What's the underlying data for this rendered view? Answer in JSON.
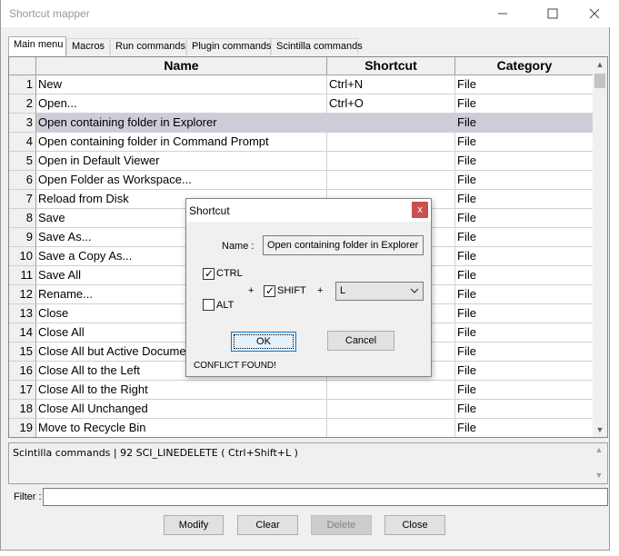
{
  "window": {
    "title": "Shortcut mapper"
  },
  "tabs": [
    "Main menu",
    "Macros",
    "Run commands",
    "Plugin commands",
    "Scintilla commands"
  ],
  "table": {
    "columns": [
      "Name",
      "Shortcut",
      "Category"
    ],
    "rows": [
      {
        "num": "1",
        "name": "New",
        "shortcut": "Ctrl+N",
        "category": "File"
      },
      {
        "num": "2",
        "name": "Open...",
        "shortcut": "Ctrl+O",
        "category": "File"
      },
      {
        "num": "3",
        "name": "Open containing folder in Explorer",
        "shortcut": "",
        "category": "File"
      },
      {
        "num": "4",
        "name": "Open containing folder in Command Prompt",
        "shortcut": "",
        "category": "File"
      },
      {
        "num": "5",
        "name": "Open in Default Viewer",
        "shortcut": "",
        "category": "File"
      },
      {
        "num": "6",
        "name": "Open Folder as Workspace...",
        "shortcut": "",
        "category": "File"
      },
      {
        "num": "7",
        "name": "Reload from Disk",
        "shortcut": "",
        "category": "File"
      },
      {
        "num": "8",
        "name": "Save",
        "shortcut": "",
        "category": "File"
      },
      {
        "num": "9",
        "name": "Save As...",
        "shortcut": "",
        "category": "File"
      },
      {
        "num": "10",
        "name": "Save a Copy As...",
        "shortcut": "",
        "category": "File"
      },
      {
        "num": "11",
        "name": "Save All",
        "shortcut": "",
        "category": "File"
      },
      {
        "num": "12",
        "name": "Rename...",
        "shortcut": "",
        "category": "File"
      },
      {
        "num": "13",
        "name": "Close",
        "shortcut": "",
        "category": "File"
      },
      {
        "num": "14",
        "name": "Close All",
        "shortcut": "",
        "category": "File"
      },
      {
        "num": "15",
        "name": "Close All but Active Docume",
        "shortcut": "",
        "category": "File"
      },
      {
        "num": "16",
        "name": "Close All to the Left",
        "shortcut": "",
        "category": "File"
      },
      {
        "num": "17",
        "name": "Close All to the Right",
        "shortcut": "",
        "category": "File"
      },
      {
        "num": "18",
        "name": "Close All Unchanged",
        "shortcut": "",
        "category": "File"
      },
      {
        "num": "19",
        "name": "Move to Recycle Bin",
        "shortcut": "",
        "category": "File"
      }
    ],
    "selected_row": "3"
  },
  "info_text": "Scintilla commands  |  92   SCI_LINEDELETE  ( Ctrl+Shift+L )",
  "filter": {
    "label": "Filter :",
    "value": ""
  },
  "buttons": {
    "modify": "Modify",
    "clear": "Clear",
    "delete": "Delete",
    "close": "Close"
  },
  "dialog": {
    "title": "Shortcut",
    "close_glyph": "x",
    "name_label": "Name :",
    "name_value": "Open containing folder in Explorer",
    "ctrl_label": "CTRL",
    "ctrl_checked": true,
    "alt_label": "ALT",
    "alt_checked": false,
    "shift_label": "SHIFT",
    "shift_checked": true,
    "plus": "+",
    "key_value": "L",
    "ok": "OK",
    "cancel": "Cancel",
    "conflict": "CONFLICT FOUND!"
  },
  "colors": {
    "selected_row": "#cdcdd9",
    "dialog_close": "#c75050"
  },
  "icons": [
    "minimize-icon",
    "maximize-icon",
    "close-icon",
    "chevron-down-icon",
    "scroll-up-icon",
    "scroll-down-icon",
    "checkmark-icon"
  ]
}
